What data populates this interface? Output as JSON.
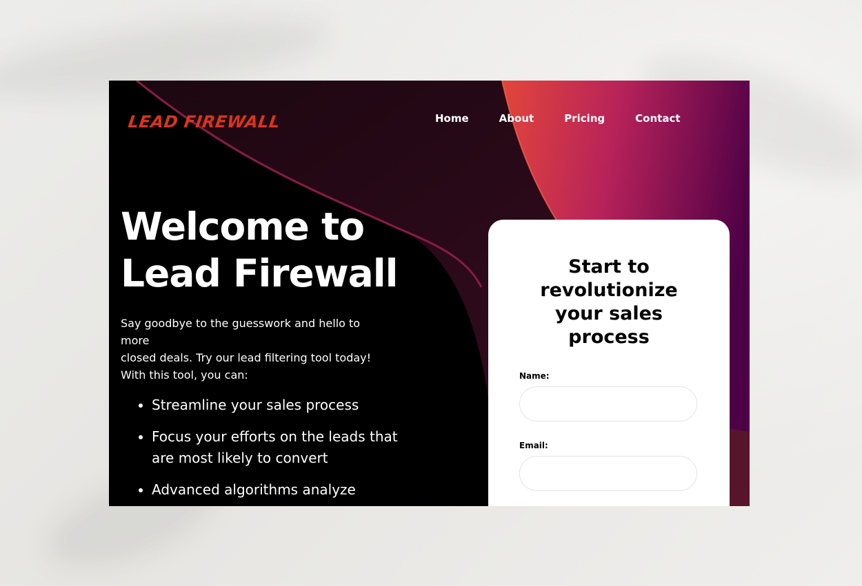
{
  "brand": {
    "logo_text": "LEAD FIREWALL",
    "logo_color": "#d9351e"
  },
  "nav": {
    "items": [
      {
        "label": "Home"
      },
      {
        "label": "About"
      },
      {
        "label": "Pricing"
      },
      {
        "label": "Contact"
      }
    ]
  },
  "hero": {
    "title_line1": "Welcome to",
    "title_line2": "Lead Firewall",
    "intro_lines": [
      "Say goodbye to the guesswork and hello to more",
      "closed deals. Try our lead filtering tool today!",
      "With this tool, you can:"
    ],
    "benefits": [
      "Streamline your sales process",
      "Focus your efforts on the leads that are most likely to convert",
      "Advanced algorithms analyze"
    ]
  },
  "form": {
    "title": "Start to revolutionize your sales process",
    "name_label": "Name:",
    "name_value": "",
    "email_label": "Email:",
    "email_value": ""
  },
  "colors": {
    "page_background": "#ebeae7",
    "hero_background": "#000000",
    "accent_red": "#e2463a",
    "accent_purple": "#5b0044",
    "text_light": "#ffffff",
    "card_background": "#ffffff"
  }
}
